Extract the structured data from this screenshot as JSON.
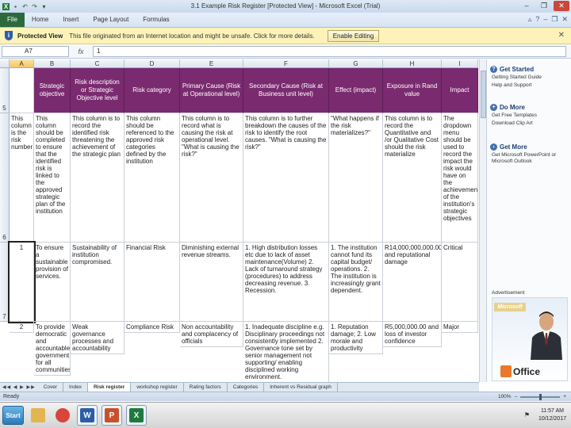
{
  "window": {
    "title": "3.1 Example Risk Register [Protected View] - Microsoft Excel (Trial)",
    "qat_icons": [
      "excel-logo-icon",
      "save-icon",
      "undo-icon",
      "redo-icon",
      "customize-icon"
    ]
  },
  "ribbon": {
    "file_label": "File",
    "tabs": [
      "Home",
      "Insert",
      "Page Layout",
      "Formulas"
    ]
  },
  "protected_view": {
    "title": "Protected View",
    "message": "This file originated from an Internet location and might be unsafe. Click for more details.",
    "button": "Enable Editing"
  },
  "formula_bar": {
    "name_box": "A7",
    "fx": "fx",
    "value": "1"
  },
  "columns": [
    "A",
    "B",
    "C",
    "D",
    "E",
    "F",
    "G",
    "H",
    "I"
  ],
  "active_column": "A",
  "row_numbers": [
    "5",
    "6",
    "7"
  ],
  "header_row": [
    "",
    "Strategic objective",
    "Risk description or Strategic Objective level",
    "Risk category",
    "Primary Cause (Risk at Operational level)",
    "Secondary Cause (Risk at Business unit level)",
    "Effect (impact)",
    "Exposure in Rand value",
    "Impact"
  ],
  "rows": [
    [
      "This column is the risk number",
      "This column should be completed to ensure that the identified risk is linked to the approved strategic plan of the institution",
      "This column is to record the identified risk threatening the achievement of the strategic plan",
      "This column should be referenced to the approved risk categories defined by the institution",
      "This column is to record what is causing the risk at operational level. \"What is causing the risk?\"",
      "This column is to further breakdown the causes of the risk to identify the root causes. \"What is causing the risk?\"",
      "\"What happens if the risk materializes?\"",
      "This column is to record the Quantitative and /or Qualitative Cost should the risk materialize",
      "The dropdown menu should be used to record the impact the risk would have on the achievement of the institution's strategic objectives"
    ],
    [
      "1",
      "To ensure a sustainable provision of services.",
      "Sustainability of institution compromised.",
      "Financial Risk",
      "Diminishing external revenue streams.",
      "1. High distribution losses etc due to lack of asset maintenance(Volume) 2. Lack of turnaround strategy (procedures) to address decreasing revenue. 3. Recession.",
      "1. The institution cannot fund its capital budget/ operations. 2. The institution is increasingly grant dependent.",
      "R14,000,000,000.00 and reputational damage",
      "Critical"
    ],
    [
      "2",
      "To provide democratic and accountable government for all communities",
      "Weak governance processes and accountability",
      "Compliance Risk",
      "Non accountability and complacency of officials",
      "1. Inadequate discipline e.g. Disciplinary proceedings not consistently implemented 2. Governance tone set by senior management not supporting/ enabling disciplined working environment.",
      "1. Reputation damage; 2. Low morale and productivity",
      "R5,000,000.00 and loss of investor confidence",
      "Major"
    ]
  ],
  "right_pane": {
    "sections": [
      {
        "title": "Get Started",
        "icon": "help-icon",
        "links": [
          "Getting Started Guide",
          "Help and Support"
        ]
      },
      {
        "title": "Do More",
        "icon": "plus-icon",
        "links": [
          "Get Free Templates",
          "Download Clip Art"
        ]
      },
      {
        "title": "Get More",
        "icon": "arrow-icon",
        "links": [
          "Get Microsoft PowerPoint or Microsoft Outlook"
        ]
      }
    ],
    "ad_label": "Advertisement",
    "ad_brand": "Microsoft",
    "ad_product": "Office"
  },
  "sheet_tabs": [
    "Cover",
    "Index",
    "Risk register",
    "workshop register",
    "Rating factors",
    "Categories",
    "Inherent vs Residual graph"
  ],
  "active_sheet": "Risk register",
  "status": {
    "text": "Ready",
    "zoom": "100%"
  },
  "taskbar": {
    "start_label": "Start",
    "apps": [
      {
        "name": "explorer",
        "letter": "",
        "color": "#e2b550"
      },
      {
        "name": "chrome",
        "letter": "",
        "color": "#d9453a"
      },
      {
        "name": "word",
        "letter": "W",
        "color": "#2a5ea8"
      },
      {
        "name": "powerpoint",
        "letter": "P",
        "color": "#c9502d"
      },
      {
        "name": "excel",
        "letter": "X",
        "color": "#1f7a3e"
      }
    ],
    "time": "11:57 AM",
    "date": "10/12/2017"
  }
}
